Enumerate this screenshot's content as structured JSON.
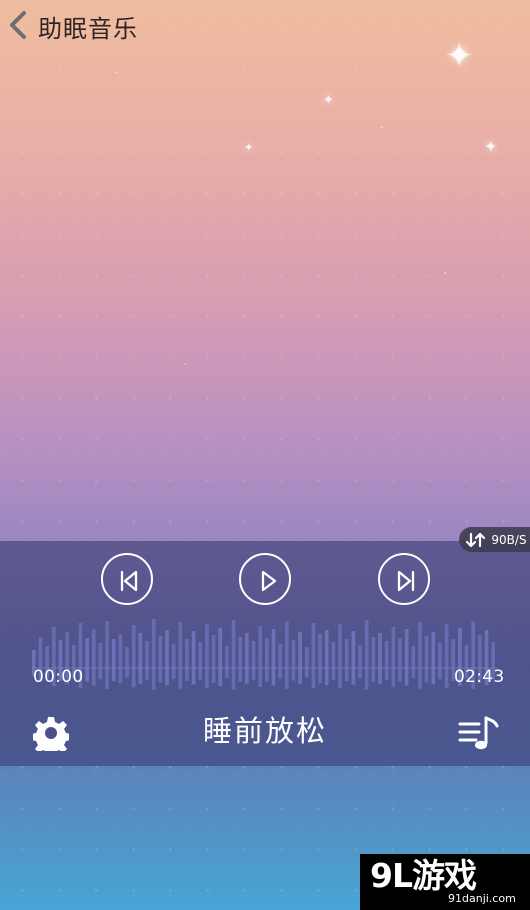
{
  "header": {
    "back_icon": "chevron-left-icon",
    "title": "助眠音乐"
  },
  "network_indicator": {
    "icon": "up-down-arrows-icon",
    "speed": "90B/S"
  },
  "controls": {
    "previous_icon": "skip-previous-icon",
    "play_icon": "play-icon",
    "next_icon": "skip-next-icon"
  },
  "progress": {
    "current_time": "00:00",
    "duration": "02:43",
    "played_fraction": 0
  },
  "now_playing": {
    "settings_icon": "gear-icon",
    "title": "睡前放松",
    "playlist_icon": "playlist-music-icon"
  },
  "watermark": {
    "logo": "9L游戏",
    "domain": "91danji.com"
  },
  "colors": {
    "panel": "#3e3e74",
    "control_white": "#ffffff",
    "waveform": "#6f76bd"
  }
}
